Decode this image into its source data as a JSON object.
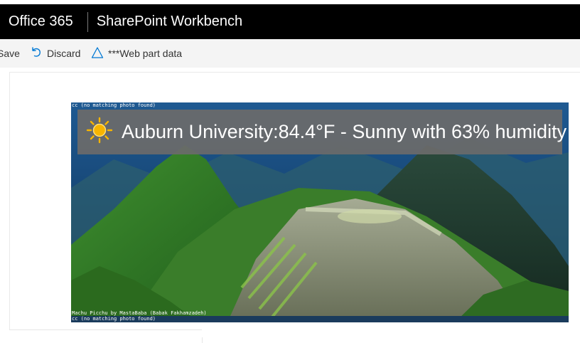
{
  "topbar": {
    "brand": "Office 365",
    "app_title": "SharePoint Workbench"
  },
  "commandbar": {
    "save_label": "Save",
    "discard_label": "Discard",
    "webpart_data_label": "***Web part data"
  },
  "webpart": {
    "weather_text": "Auburn University:84.4°F - Sunny with 63% humidity",
    "weather_icon": "sun-icon",
    "credit_top": "cc (no matching photo found)",
    "credit_photo": "Machu Picchu by MastaBaba (Babak Fakhamzadeh)",
    "credit_bottom": "cc (no matching photo found)"
  },
  "colors": {
    "topbar_bg": "#000000",
    "commandbar_bg": "#f4f4f4",
    "accent_blue": "#0078d4",
    "overlay_bg": "#6a6a6a",
    "sun": "#f7b500"
  }
}
